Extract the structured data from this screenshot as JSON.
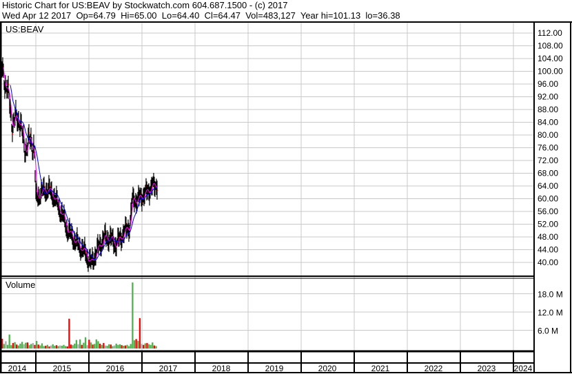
{
  "header": {
    "title": "Historic Chart for US:BEAV by Stockwatch.com 604.687.1500 - (c) 2017",
    "quote": "Wed Apr 12 2017  Op=64.79  Hi=65.00  Lo=64.40  Cl=64.47  Vol=483,127  Year hi=101.13  lo=36.38"
  },
  "chart_data": {
    "type": "line",
    "symbol": "US:BEAV",
    "volume_label": "Volume",
    "colors": {
      "up": "#4db34d",
      "down": "#ff0000",
      "bar": "#000000",
      "ma_short": "#ff00ff",
      "ma_long": "#0000ff",
      "grid": "#c8c8c8"
    },
    "price_ticks": [
      "112.00",
      "108.00",
      "104.00",
      "100.00",
      "96.00",
      "92.00",
      "88.00",
      "84.00",
      "80.00",
      "76.00",
      "72.00",
      "68.00",
      "64.00",
      "60.00",
      "56.00",
      "52.00",
      "48.00",
      "44.00",
      "40.00"
    ],
    "price_range": [
      36,
      114
    ],
    "volume_ticks": [
      "18.0 M",
      "12.0 M",
      "6.0 M"
    ],
    "volume_range_millions": [
      0,
      22
    ],
    "years": [
      "2014",
      "2015",
      "2016",
      "2017",
      "2018",
      "2019",
      "2020",
      "2021",
      "2022",
      "2023",
      "2024"
    ],
    "x_range_years": [
      2014.32,
      2024.4
    ],
    "closes": [
      [
        2014.35,
        100.8
      ],
      [
        2014.45,
        95.4
      ],
      [
        2014.56,
        83.5
      ],
      [
        2014.69,
        85.6
      ],
      [
        2014.78,
        76
      ],
      [
        2014.91,
        78
      ],
      [
        2014.97,
        76.5
      ],
      [
        2015.0,
        59.7
      ],
      [
        2015.1,
        62
      ],
      [
        2015.23,
        63
      ],
      [
        2015.34,
        60.8
      ],
      [
        2015.43,
        57.5
      ],
      [
        2015.52,
        54
      ],
      [
        2015.6,
        50
      ],
      [
        2015.69,
        48
      ],
      [
        2015.79,
        45.6
      ],
      [
        2015.86,
        44.5
      ],
      [
        2015.95,
        42.4
      ],
      [
        2016.04,
        39.6
      ],
      [
        2016.12,
        42.4
      ],
      [
        2016.21,
        45.6
      ],
      [
        2016.3,
        47.8
      ],
      [
        2016.4,
        47.6
      ],
      [
        2016.51,
        45.6
      ],
      [
        2016.6,
        47.8
      ],
      [
        2016.69,
        50
      ],
      [
        2016.77,
        51.5
      ],
      [
        2016.82,
        59.7
      ],
      [
        2016.92,
        59.7
      ],
      [
        2017.05,
        61.4
      ],
      [
        2017.18,
        63.6
      ],
      [
        2017.29,
        64.6
      ]
    ],
    "volume_millions": [
      3.2,
      1.5,
      2.4,
      1.2,
      4.6,
      1.1,
      1.8,
      2.1,
      1.3,
      1.0,
      1.6,
      2.2,
      1.4,
      1.9,
      2.0,
      1.1,
      1.5,
      1.8,
      1.2,
      2.5,
      1.3,
      1.0,
      1.7,
      0.8,
      0.9,
      1.2,
      0.7,
      1.0,
      1.4,
      0.9,
      1.1,
      0.8,
      1.0,
      0.9,
      1.2,
      0.8,
      0.7,
      9.8,
      1.3,
      1.1,
      1.6,
      2.8,
      1.4,
      3.0,
      1.2,
      1.9,
      3.7,
      1.1,
      2.9,
      2.0,
      1.3,
      1.5,
      3.0,
      2.4,
      1.6,
      1.2,
      1.8,
      1.0,
      0.9,
      1.4,
      1.3,
      0.8,
      1.0,
      1.6,
      1.2,
      1.4,
      1.1,
      0.9,
      1.0,
      1.2,
      0.8,
      1.5,
      21.7,
      2.7,
      3.1,
      2.5,
      10.0,
      1.5,
      1.2,
      1.7,
      1.8,
      1.4,
      1.2,
      2.0,
      1.0,
      0.8
    ]
  }
}
